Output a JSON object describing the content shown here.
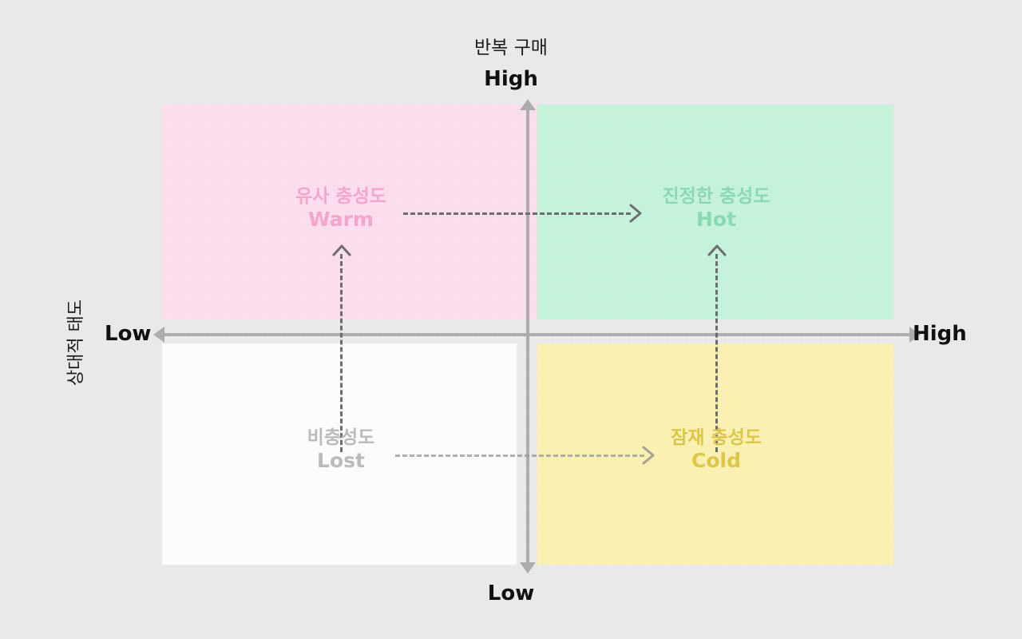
{
  "chart_data": {
    "type": "scatter",
    "title": "",
    "xlabel": "상대적 태도",
    "ylabel": "반복 구매",
    "grid": false,
    "legend": "none",
    "axes": {
      "vertical": {
        "name_ko": "반복 구매",
        "high_label": "High",
        "low_label": "Low"
      },
      "horizontal": {
        "name_ko": "상대적 태도",
        "low_label": "Low",
        "high_label": "High"
      }
    },
    "quadrants": [
      {
        "key": "warm",
        "position": "top-left",
        "name_ko": "유사 충성도",
        "name_en": "Warm",
        "fill": "#FEE0F0",
        "text_color": "#F7A8CF",
        "attitude": "Low",
        "repeat_purchase": "High"
      },
      {
        "key": "hot",
        "position": "top-right",
        "name_ko": "진정한 충성도",
        "name_en": "Hot",
        "fill": "#C8F5DE",
        "text_color": "#8DDCB3",
        "attitude": "High",
        "repeat_purchase": "High"
      },
      {
        "key": "lost",
        "position": "bottom-left",
        "name_ko": "비충성도",
        "name_en": "Lost",
        "fill": "#FFFFFF",
        "text_color": "#BDBDBD",
        "attitude": "Low",
        "repeat_purchase": "Low"
      },
      {
        "key": "cold",
        "position": "bottom-right",
        "name_ko": "잠재 충성도",
        "name_en": "Cold",
        "fill": "#FCF3B4",
        "text_color": "#DFC94A",
        "attitude": "High",
        "repeat_purchase": "Low"
      }
    ],
    "transitions": [
      {
        "from": "warm",
        "to": "hot",
        "direction": "right"
      },
      {
        "from": "lost",
        "to": "cold",
        "direction": "right"
      },
      {
        "from": "lost",
        "to": "warm",
        "direction": "up"
      },
      {
        "from": "cold",
        "to": "hot",
        "direction": "up"
      }
    ]
  },
  "colors": {
    "background": "#ececec",
    "axis": "#AFAFAF",
    "dash": "#6f6f6f",
    "dash_muted": "#9a9a9a",
    "caption": "#111111"
  }
}
